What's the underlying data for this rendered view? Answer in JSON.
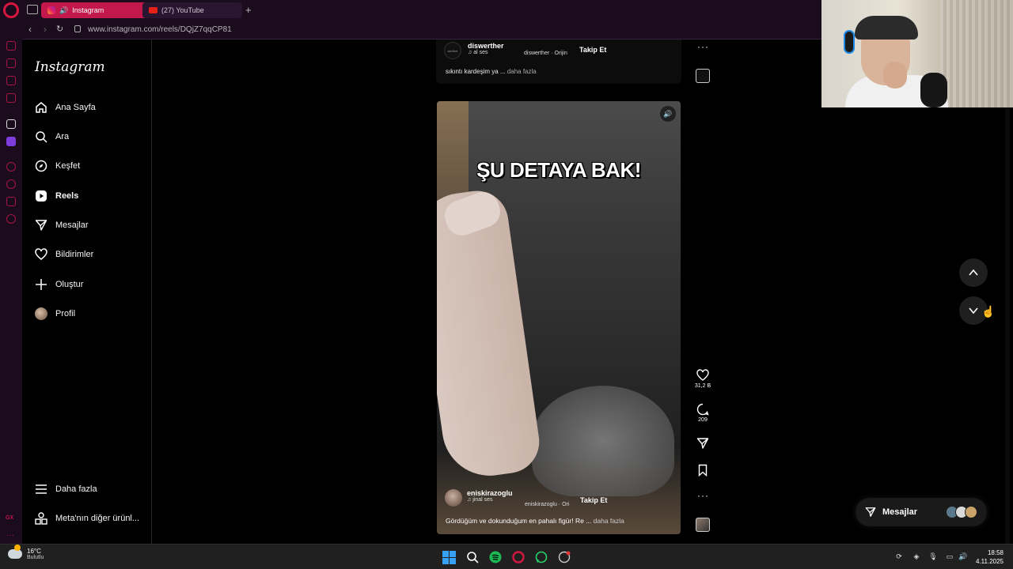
{
  "browser": {
    "tabs": [
      {
        "label": "Instagram",
        "active": true,
        "icon": "instagram-icon"
      },
      {
        "label": "(27) YouTube",
        "active": false,
        "icon": "youtube-icon"
      }
    ],
    "url": "www.instagram.com/reels/DQjZ7qqCP81",
    "accent": "#c2184b"
  },
  "instagram": {
    "logo": "Instagram",
    "nav": [
      {
        "label": "Ana Sayfa",
        "icon": "home-icon"
      },
      {
        "label": "Ara",
        "icon": "search-icon"
      },
      {
        "label": "Keşfet",
        "icon": "compass-icon"
      },
      {
        "label": "Reels",
        "icon": "reels-icon",
        "active": true
      },
      {
        "label": "Mesajlar",
        "icon": "send-icon"
      },
      {
        "label": "Bildirimler",
        "icon": "heart-icon"
      },
      {
        "label": "Oluştur",
        "icon": "plus-icon"
      },
      {
        "label": "Profil",
        "icon": "avatar"
      }
    ],
    "more": "Daha fazla",
    "meta": "Meta'nın diğer ürünl...",
    "prev_reel": {
      "username": "diswerther",
      "audio": "al ses",
      "origin": "diswerther · Orijin",
      "follow": "Takip Et",
      "caption": "sıkıntı kardeşim ya ...",
      "more": "daha fazla",
      "avatar_text": "werther"
    },
    "reel": {
      "overlay_title": "ŞU DETAYA BAK!",
      "username": "eniskirazoglu",
      "audio": "jinal ses",
      "origin": "eniskirazoglu · Ori",
      "follow": "Takip Et",
      "caption": "Gördüğüm ve dokunduğum en pahalı figür! Re ...",
      "more": "daha fazla",
      "likes": "31,2 B",
      "comments": "209"
    },
    "messages_label": "Mesajlar"
  },
  "taskbar": {
    "weather_temp": "16°C",
    "weather_desc": "Bulutlu",
    "time": "18:58",
    "date": "4.11.2025"
  }
}
